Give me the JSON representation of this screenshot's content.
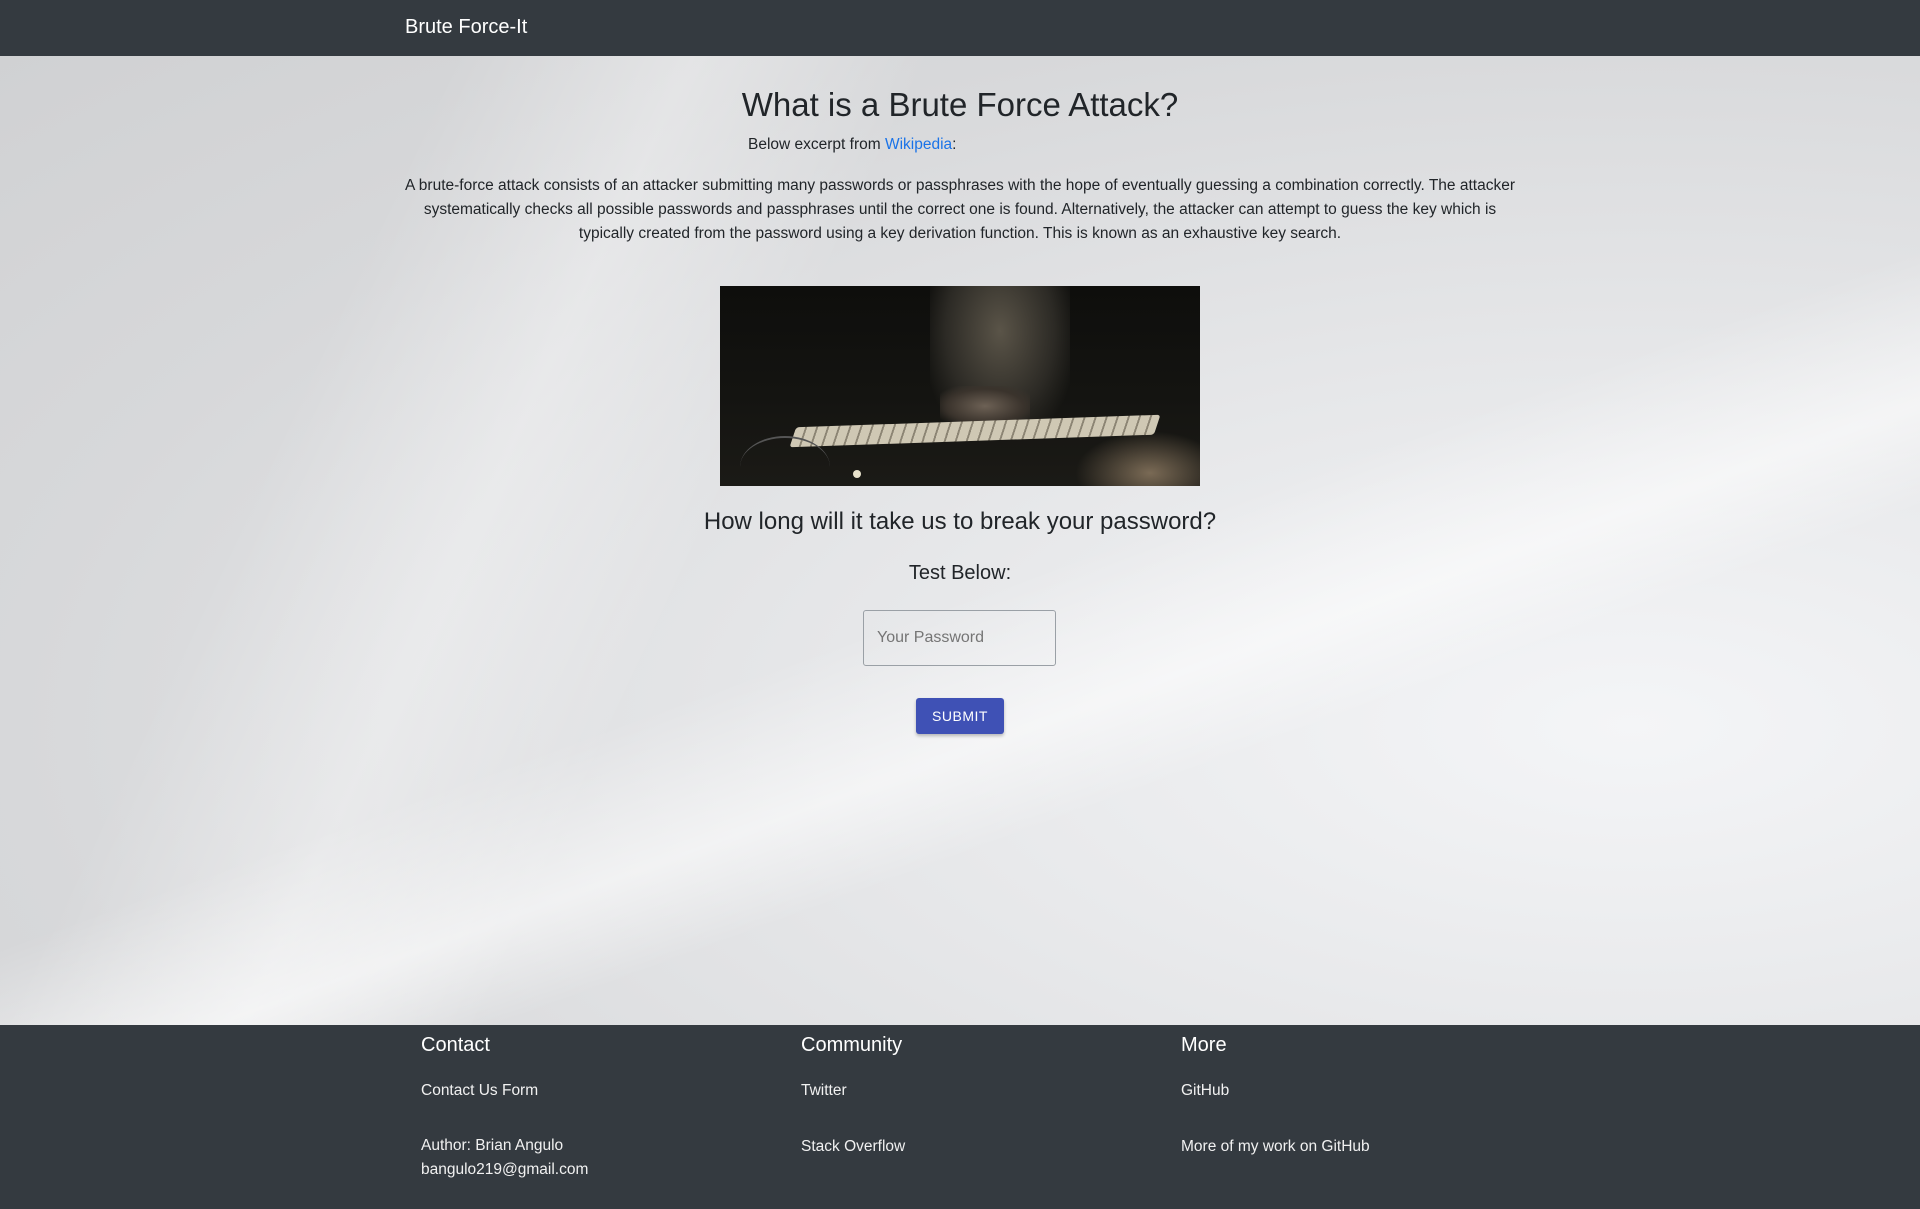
{
  "navbar": {
    "brand": "Brute Force-It"
  },
  "main": {
    "title": "What is a Brute Force Attack?",
    "excerpt_prefix": "Below excerpt from ",
    "excerpt_link": "Wikipedia",
    "excerpt_suffix": ":",
    "paragraph": "A brute-force attack consists of an attacker submitting many passwords or passphrases with the hope of eventually guessing a combination correctly. The attacker systematically checks all possible passwords and passphrases until the correct one is found. Alternatively, the attacker can attempt to guess the key which is typically created from the password using a key derivation function. This is known as an exhaustive key search.",
    "question": "How long will it take us to break your password?",
    "test_below": "Test Below:",
    "password_placeholder": "Your Password",
    "password_value": "",
    "submit_label": "SUBMIT"
  },
  "footer": {
    "contact": {
      "heading": "Contact",
      "link": "Contact Us Form",
      "author": "Author: Brian Angulo",
      "email": "bangulo219@gmail.com"
    },
    "community": {
      "heading": "Community",
      "twitter": "Twitter",
      "stackoverflow": "Stack Overflow"
    },
    "more": {
      "heading": "More",
      "github": "GitHub",
      "more_work": "More of my work on GitHub"
    }
  },
  "colors": {
    "navbar_bg": "#343a40",
    "link": "#1a73e8",
    "submit_bg": "#3f51b5"
  }
}
